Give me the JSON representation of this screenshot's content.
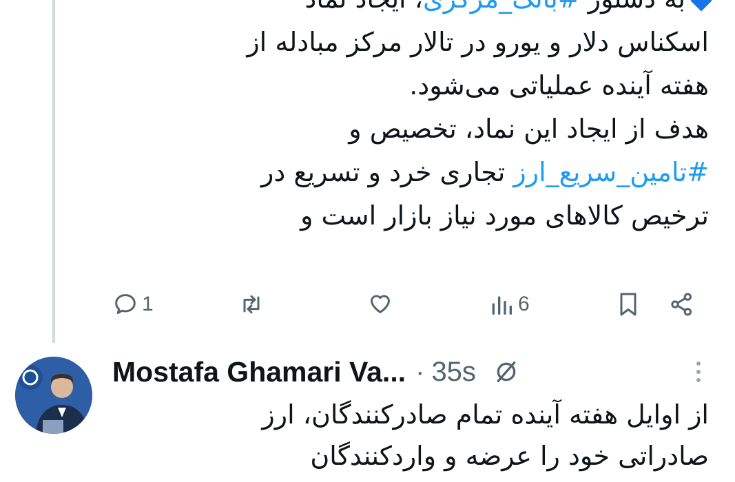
{
  "tweet1": {
    "lines": [
      {
        "before": "به دستور ",
        "hashtag": "#بانک_مرکزی",
        "after": "، ایجاد نماد"
      },
      {
        "text": "اسکناس دلار و یورو در تالار مرکز مبادله از"
      },
      {
        "text": "هفته آینده عملیاتی می‌شود."
      },
      {
        "text": "هدف از ایجاد این نماد، تخصیص و"
      },
      {
        "hashtag": "#تامین_سریع_ارز",
        "after": " تجاری خرد و تسریع در"
      },
      {
        "text": "ترخیص کالاهای مورد نیاز بازار است و"
      }
    ],
    "actions": {
      "reply_count": "1",
      "retweet_count": "",
      "like_count": "",
      "views_count": "6"
    },
    "colors": {
      "hashtag": "#1d9bf0",
      "icon": "#536471",
      "diamond": "#1a73e8"
    }
  },
  "tweet2": {
    "author_name": "Mostafa Ghamari Va...",
    "separator": "·",
    "time": "35s",
    "lines": [
      "از اوایل هفته آینده تمام صادرکنندگان، ارز",
      "صادراتی خود را عرضه و واردکنندگان"
    ],
    "icons": [
      "edit-slash-icon",
      "more-vertical-icon"
    ]
  }
}
